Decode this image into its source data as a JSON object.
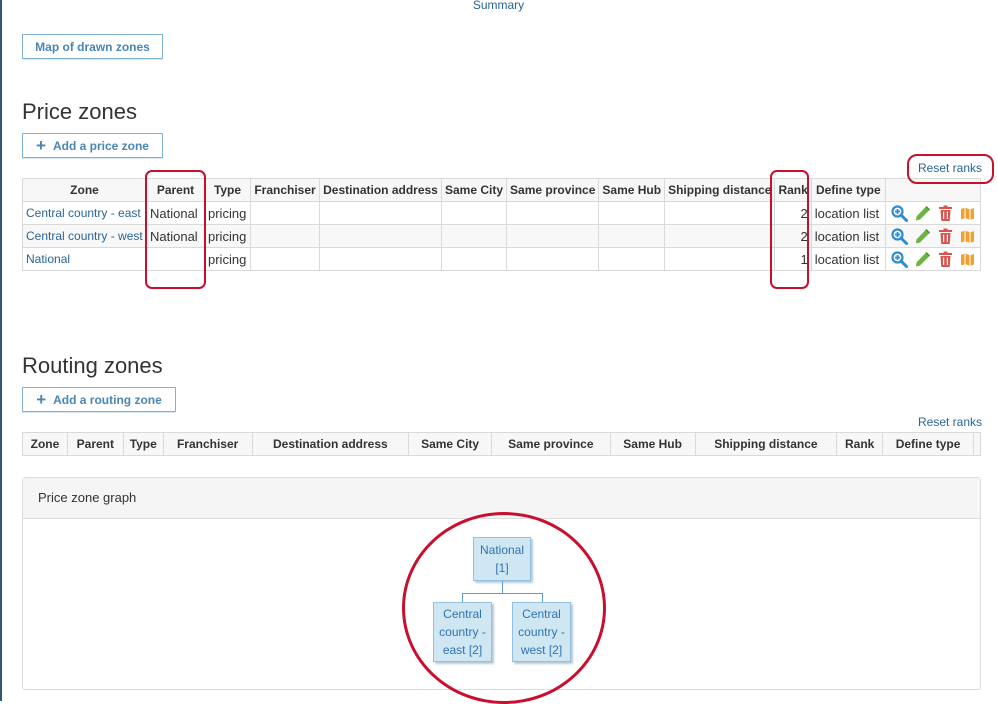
{
  "summary_link": "Summary",
  "map_button": "Map of drawn zones",
  "price_zones": {
    "title": "Price zones",
    "add_button": "Add a price zone",
    "reset_ranks": "Reset ranks",
    "columns": [
      "Zone",
      "Parent",
      "Type",
      "Franchiser",
      "Destination address",
      "Same City",
      "Same province",
      "Same Hub",
      "Shipping distance",
      "Rank",
      "Define type"
    ],
    "rows": [
      {
        "zone": "Central country - east",
        "parent": "National",
        "type": "pricing",
        "rank": "2",
        "define_type": "location list"
      },
      {
        "zone": "Central country - west",
        "parent": "National",
        "type": "pricing",
        "rank": "2",
        "define_type": "location list"
      },
      {
        "zone": "National",
        "parent": "",
        "type": "pricing",
        "rank": "1",
        "define_type": "location list"
      }
    ]
  },
  "routing_zones": {
    "title": "Routing zones",
    "add_button": "Add a routing zone",
    "reset_ranks": "Reset ranks",
    "columns": [
      "Zone",
      "Parent",
      "Type",
      "Franchiser",
      "Destination address",
      "Same City",
      "Same province",
      "Same Hub",
      "Shipping distance",
      "Rank",
      "Define type"
    ]
  },
  "graph": {
    "title": "Price zone graph",
    "nodes": {
      "root": [
        "National",
        "[1]"
      ],
      "east": [
        "Central",
        "country -",
        "east [2]"
      ],
      "west": [
        "Central",
        "country -",
        "west [2]"
      ]
    }
  },
  "colors": {
    "link": "#2a6496",
    "annotation_red": "#c8102e",
    "node_fill": "#cfe6f3",
    "zoom_icon": "#2a8dd4",
    "edit_icon": "#6bb344",
    "delete_icon": "#d9534f",
    "map_icon": "#f0a030"
  },
  "icons": [
    "zoom-in-icon",
    "pencil-icon",
    "trash-icon",
    "map-icon"
  ]
}
